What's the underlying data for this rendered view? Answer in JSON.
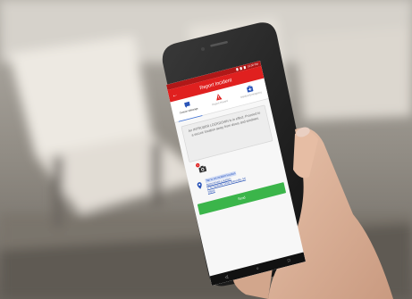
{
  "status_bar": {
    "time": "12:30 PM"
  },
  "header": {
    "title": "Report Incident",
    "back_icon": "back-arrow-icon"
  },
  "tabs": [
    {
      "label": "Custom Message",
      "icon": "speech-bubble-icon",
      "color": "#2b55b8",
      "active": true
    },
    {
      "label": "Report Hazard",
      "icon": "warning-triangle-icon",
      "color": "#e0201f",
      "active": false
    },
    {
      "label": "Medical Emergency",
      "icon": "medical-kit-icon",
      "color": "#2b55b8",
      "active": false
    }
  ],
  "message": {
    "text": "An INTRUDER LOCKDOWN is in effect. Proceed to a secure location away from doors and windows."
  },
  "attachment": {
    "icon": "camera-icon",
    "badge": "1"
  },
  "location": {
    "icon": "location-pin-icon",
    "hint": "Tap to set incident location",
    "address_line1": "Approximate Location:",
    "address_line2": "1730 Nashville Drive Batesville, MI",
    "address_line3": "38606"
  },
  "send_button": {
    "label": "Send"
  },
  "colors": {
    "brand_red": "#e0201f",
    "accent_blue": "#2b55b8",
    "send_green": "#3bb54a"
  }
}
